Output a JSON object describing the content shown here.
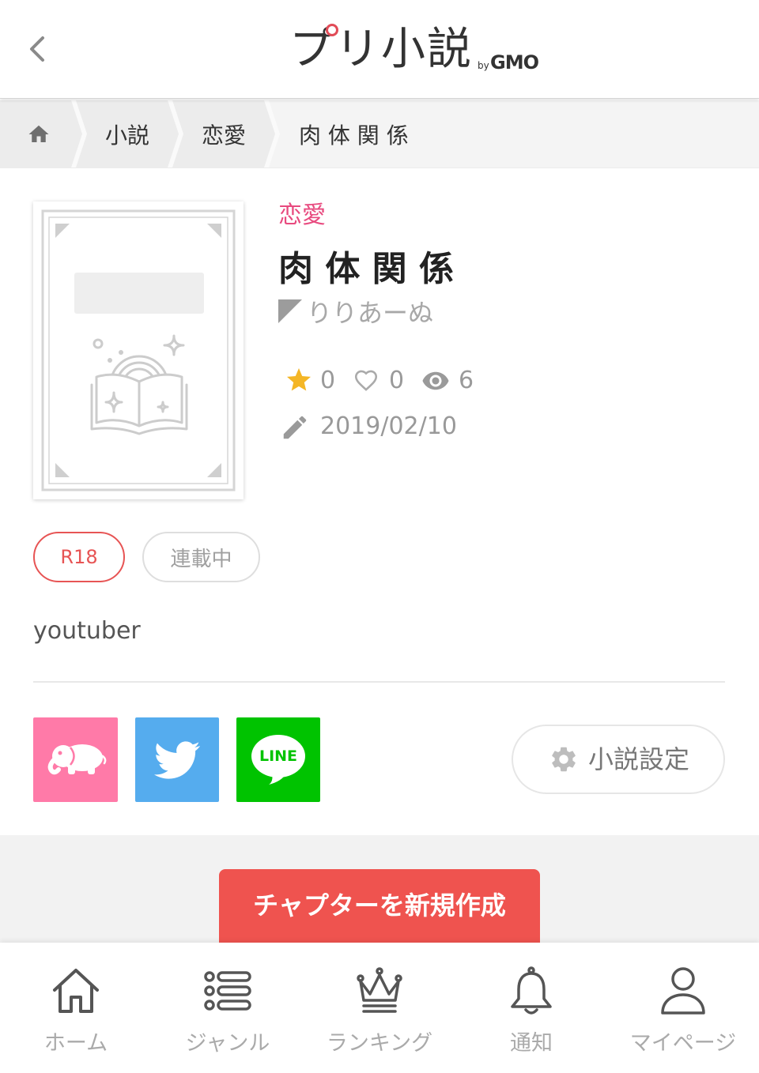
{
  "header": {
    "back_icon": "chevron-left-icon",
    "logo": {
      "name": "プリ小説",
      "by": "by",
      "company": "GMO"
    }
  },
  "breadcrumb": {
    "home_icon": "home-icon",
    "items": [
      "小説",
      "恋愛",
      "肉 体 関 係"
    ]
  },
  "novel": {
    "genre": "恋愛",
    "title": "肉 体 関 係",
    "author": "りりあーぬ",
    "stats": {
      "favorites": 0,
      "likes": 0,
      "views": 6
    },
    "updated_date": "2019/02/10",
    "tags": [
      "R18",
      "連載中"
    ],
    "description": "youtuber"
  },
  "share": {
    "icons": [
      "elephant-icon",
      "twitter-bird-icon",
      "line-icon"
    ],
    "line_label": "LINE"
  },
  "settings_button": {
    "label": "小説設定",
    "icon": "gear-icon"
  },
  "create_chapter_button": {
    "label": "チャプターを新規作成"
  },
  "bottom_nav": {
    "items": [
      {
        "label": "ホーム",
        "icon": "home-outline-icon"
      },
      {
        "label": "ジャンル",
        "icon": "list-icon"
      },
      {
        "label": "ランキング",
        "icon": "crown-icon"
      },
      {
        "label": "通知",
        "icon": "bell-icon"
      },
      {
        "label": "マイページ",
        "icon": "person-icon"
      }
    ]
  },
  "colors": {
    "genre": "#e84a7f",
    "r18": "#e75454",
    "create_button": "#ef534f",
    "share_pink": "#ff7aa8",
    "share_twitter": "#55acee",
    "share_line": "#00c300",
    "star": "#f4b626"
  }
}
